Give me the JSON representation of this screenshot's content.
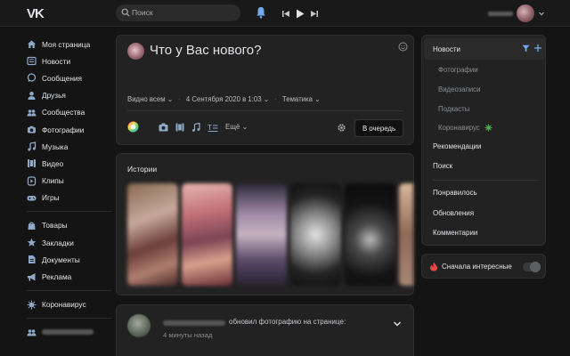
{
  "header": {
    "logo_text": "VK",
    "search_placeholder": "Поиск"
  },
  "nav": {
    "items": [
      {
        "label": "Моя страница",
        "icon": "home-icon"
      },
      {
        "label": "Новости",
        "icon": "news-icon"
      },
      {
        "label": "Сообщения",
        "icon": "messages-icon"
      },
      {
        "label": "Друзья",
        "icon": "friends-icon"
      },
      {
        "label": "Сообщества",
        "icon": "groups-icon"
      },
      {
        "label": "Фотографии",
        "icon": "camera-icon"
      },
      {
        "label": "Музыка",
        "icon": "music-icon"
      },
      {
        "label": "Видео",
        "icon": "video-icon"
      },
      {
        "label": "Клипы",
        "icon": "clips-icon"
      },
      {
        "label": "Игры",
        "icon": "gamepad-icon"
      }
    ],
    "items2": [
      {
        "label": "Товары",
        "icon": "bag-icon"
      },
      {
        "label": "Закладки",
        "icon": "star-icon"
      },
      {
        "label": "Документы",
        "icon": "document-icon"
      },
      {
        "label": "Реклама",
        "icon": "megaphone-icon"
      }
    ],
    "items3": [
      {
        "label": "Коронавирус",
        "icon": "virus-icon"
      }
    ]
  },
  "composer": {
    "placeholder": "Что у Вас нового?",
    "visibility": "Видно всем",
    "datetime": "4 Сентября 2020 в 1:03",
    "topic": "Тематика",
    "more": "Ещё",
    "submit": "В очередь"
  },
  "stories": {
    "title": "Истории"
  },
  "post": {
    "action": "обновил фотографию на странице:",
    "time": "4 минуты назад"
  },
  "right_menu": {
    "news": "Новости",
    "sub": [
      "Фотографии",
      "Видеозаписи",
      "Подкасты",
      "Коронавирус"
    ],
    "recommendations": "Рекомендации",
    "search": "Поиск",
    "liked": "Понравилось",
    "updates": "Обновления",
    "comments": "Комментарии"
  },
  "interesting_first": {
    "label": "Сначала интересные",
    "enabled": false
  },
  "colors": {
    "background": "#141414",
    "card": "#222222",
    "accent": "#71aaeb",
    "virus_badge": "#4bb34b"
  }
}
